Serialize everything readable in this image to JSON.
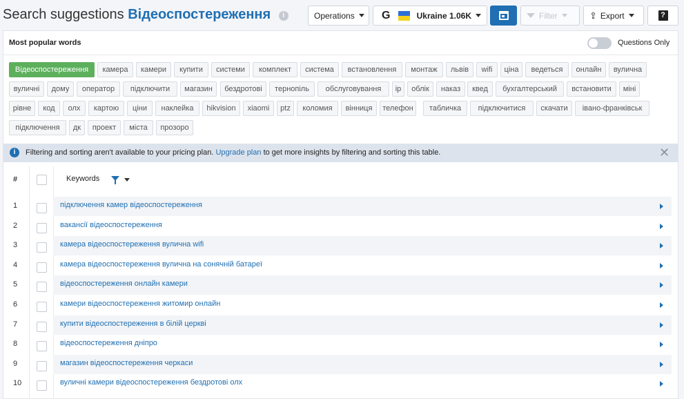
{
  "header": {
    "title_prefix": "Search suggestions",
    "title_keyword": "Відеоспостереження",
    "operations_label": "Operations",
    "database_label": "Ukraine 1.06K",
    "filter_label": "Filter",
    "export_label": "Export",
    "help_label": "?"
  },
  "popular": {
    "title": "Most popular words",
    "questions_only_label": "Questions Only",
    "tags": [
      "Відеоспостереження",
      "камера",
      "камери",
      "купити",
      "системи",
      "комплект",
      "система",
      "встановлення",
      "монтаж",
      "львів",
      "wifi",
      "ціна",
      "ведеться",
      "онлайн",
      "вулична",
      "вуличні",
      "дому",
      "оператор",
      "підключити",
      "магазин",
      "бездротові",
      "тернопіль",
      "обслуговування",
      "ip",
      "облік",
      "наказ",
      "квед",
      "бухгалтерський",
      "встановити",
      "міні",
      "рівне",
      "код",
      "олх",
      "картою",
      "ціни",
      "наклейка",
      "hikvision",
      "xiaomi",
      "ptz",
      "коломия",
      "вінниця",
      "телефон",
      "табличка",
      "підключитися",
      "скачати",
      "івано-франківськ",
      "підключення",
      "дк",
      "проект",
      "міста",
      "прозоро"
    ]
  },
  "banner": {
    "text_before": "Filtering and sorting aren't available to your pricing plan.",
    "link": "Upgrade plan",
    "text_after": "to get more insights by filtering and sorting this table."
  },
  "table": {
    "col_number": "#",
    "col_keywords": "Keywords",
    "rows": [
      {
        "n": "1",
        "keyword": "підключення камер відеоспостереження"
      },
      {
        "n": "2",
        "keyword": "вакансії відеоспостереження"
      },
      {
        "n": "3",
        "keyword": "камера відеоспостереження вулична wifi"
      },
      {
        "n": "4",
        "keyword": "камера відеоспостереження вулична на сонячній батареї"
      },
      {
        "n": "5",
        "keyword": "відеоспостереження онлайн камери"
      },
      {
        "n": "6",
        "keyword": "камери відеоспостереження житомир онлайн"
      },
      {
        "n": "7",
        "keyword": "купити відеоспостереження в білій церкві"
      },
      {
        "n": "8",
        "keyword": "відеоспостереження дніпро"
      },
      {
        "n": "9",
        "keyword": "магазин відеоспостереження черкаси"
      },
      {
        "n": "10",
        "keyword": "вуличні камери відеоспостереження бездротові олх"
      }
    ]
  },
  "colors": {
    "accent": "#1f6fb2",
    "active_tag": "#5cb05c",
    "banner_bg": "#dde3ec"
  }
}
